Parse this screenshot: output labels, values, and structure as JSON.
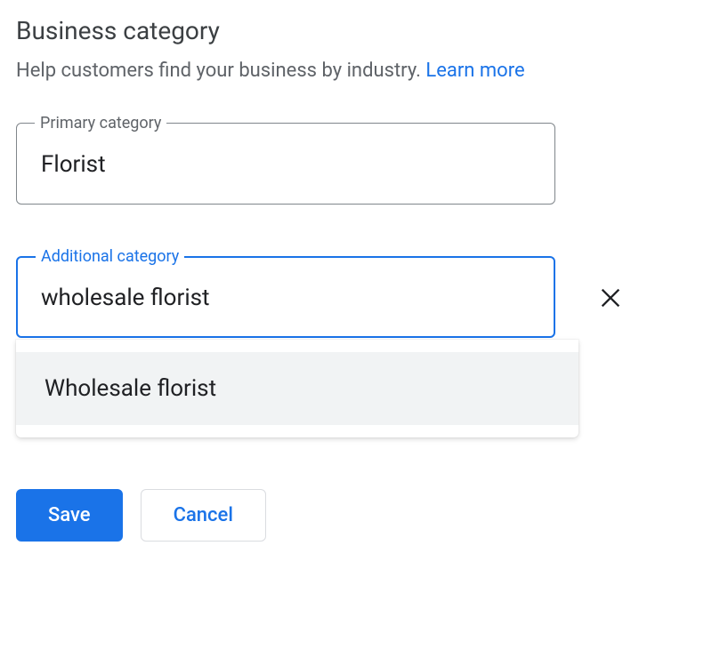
{
  "section": {
    "title": "Business category",
    "help_text_prefix": "Help customers find your business by industry. ",
    "learn_more": "Learn more"
  },
  "primary": {
    "label": "Primary category",
    "value": "Florist"
  },
  "additional": {
    "label": "Additional category",
    "value": "wholesale florist",
    "suggestion": "Wholesale florist"
  },
  "buttons": {
    "save": "Save",
    "cancel": "Cancel"
  }
}
